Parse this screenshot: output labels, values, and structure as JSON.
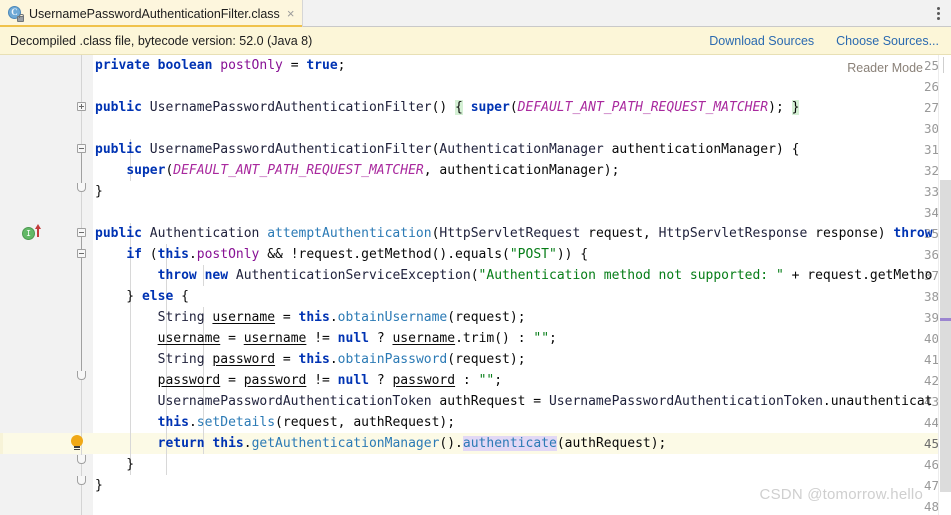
{
  "tab": {
    "title": "UsernamePasswordAuthenticationFilter.class",
    "close_label": "×",
    "icon": "java-class-icon"
  },
  "tabbar": {
    "menu_icon": "kebab-menu-icon"
  },
  "banner": {
    "text": "Decompiled .class file, bytecode version: 52.0 (Java 8)",
    "download_sources_label": "Download Sources",
    "choose_sources_label": "Choose Sources..."
  },
  "editor": {
    "reader_mode_label": "Reader Mode",
    "watermark": "CSDN @tomorrow.hello",
    "current_line": 45,
    "lines": [
      {
        "no": "25",
        "indent": 1
      },
      {
        "no": "26",
        "indent": 0
      },
      {
        "no": "27",
        "indent": 1
      },
      {
        "no": "30",
        "indent": 0
      },
      {
        "no": "31",
        "indent": 1
      },
      {
        "no": "32",
        "indent": 2
      },
      {
        "no": "33",
        "indent": 1
      },
      {
        "no": "34",
        "indent": 0
      },
      {
        "no": "35",
        "indent": 1
      },
      {
        "no": "36",
        "indent": 2
      },
      {
        "no": "37",
        "indent": 3
      },
      {
        "no": "38",
        "indent": 2
      },
      {
        "no": "39",
        "indent": 3
      },
      {
        "no": "40",
        "indent": 3
      },
      {
        "no": "41",
        "indent": 3
      },
      {
        "no": "42",
        "indent": 3
      },
      {
        "no": "43",
        "indent": 3
      },
      {
        "no": "44",
        "indent": 3
      },
      {
        "no": "45",
        "indent": 3
      },
      {
        "no": "46",
        "indent": 2
      },
      {
        "no": "47",
        "indent": 1
      },
      {
        "no": "48",
        "indent": 0
      }
    ],
    "code": {
      "l25": "    private boolean postOnly = true;",
      "l26": "",
      "l27": "    public UsernamePasswordAuthenticationFilter() { super(DEFAULT_ANT_PATH_REQUEST_MATCHER); }",
      "l30": "",
      "l31": "    public UsernamePasswordAuthenticationFilter(AuthenticationManager authenticationManager) {",
      "l32": "        super(DEFAULT_ANT_PATH_REQUEST_MATCHER, authenticationManager);",
      "l33": "    }",
      "l34": "",
      "l35": "    public Authentication attemptAuthentication(HttpServletRequest request, HttpServletResponse response) throws",
      "l36": "        if (this.postOnly && !request.getMethod().equals(\"POST\")) {",
      "l37": "            throw new AuthenticationServiceException(\"Authentication method not supported: \" + request.getMetho",
      "l38": "        } else {",
      "l39": "            String username = this.obtainUsername(request);",
      "l40": "            username = username != null ? username.trim() : \"\";",
      "l41": "            String password = this.obtainPassword(request);",
      "l42": "            password = password != null ? password : \"\";",
      "l43": "            UsernamePasswordAuthenticationToken authRequest = UsernamePasswordAuthenticationToken.unauthenticat",
      "l44": "            this.setDetails(request, authRequest);",
      "l45": "            return this.getAuthenticationManager().authenticate(authRequest);",
      "l46": "        }",
      "l47": "    }",
      "l48": ""
    },
    "gutter_icons": {
      "line35_override": "method-override-icon",
      "line45_bulb": "intention-bulb-icon"
    }
  },
  "colors": {
    "tab_active_bg": "#fdf6dd",
    "banner_bg": "#fcf6d8",
    "link": "#2b6ab0",
    "keyword": "#0033b3",
    "string": "#067d17",
    "field": "#871094",
    "constant": "#a9299e",
    "method_decl": "#2b7ab5",
    "current_line_bg": "#fcfae6",
    "brace_match_bg": "#d4f0d4",
    "identifier_hl_bg": "#e2d8f5",
    "scrollbar_mark": "#9b85d0"
  }
}
